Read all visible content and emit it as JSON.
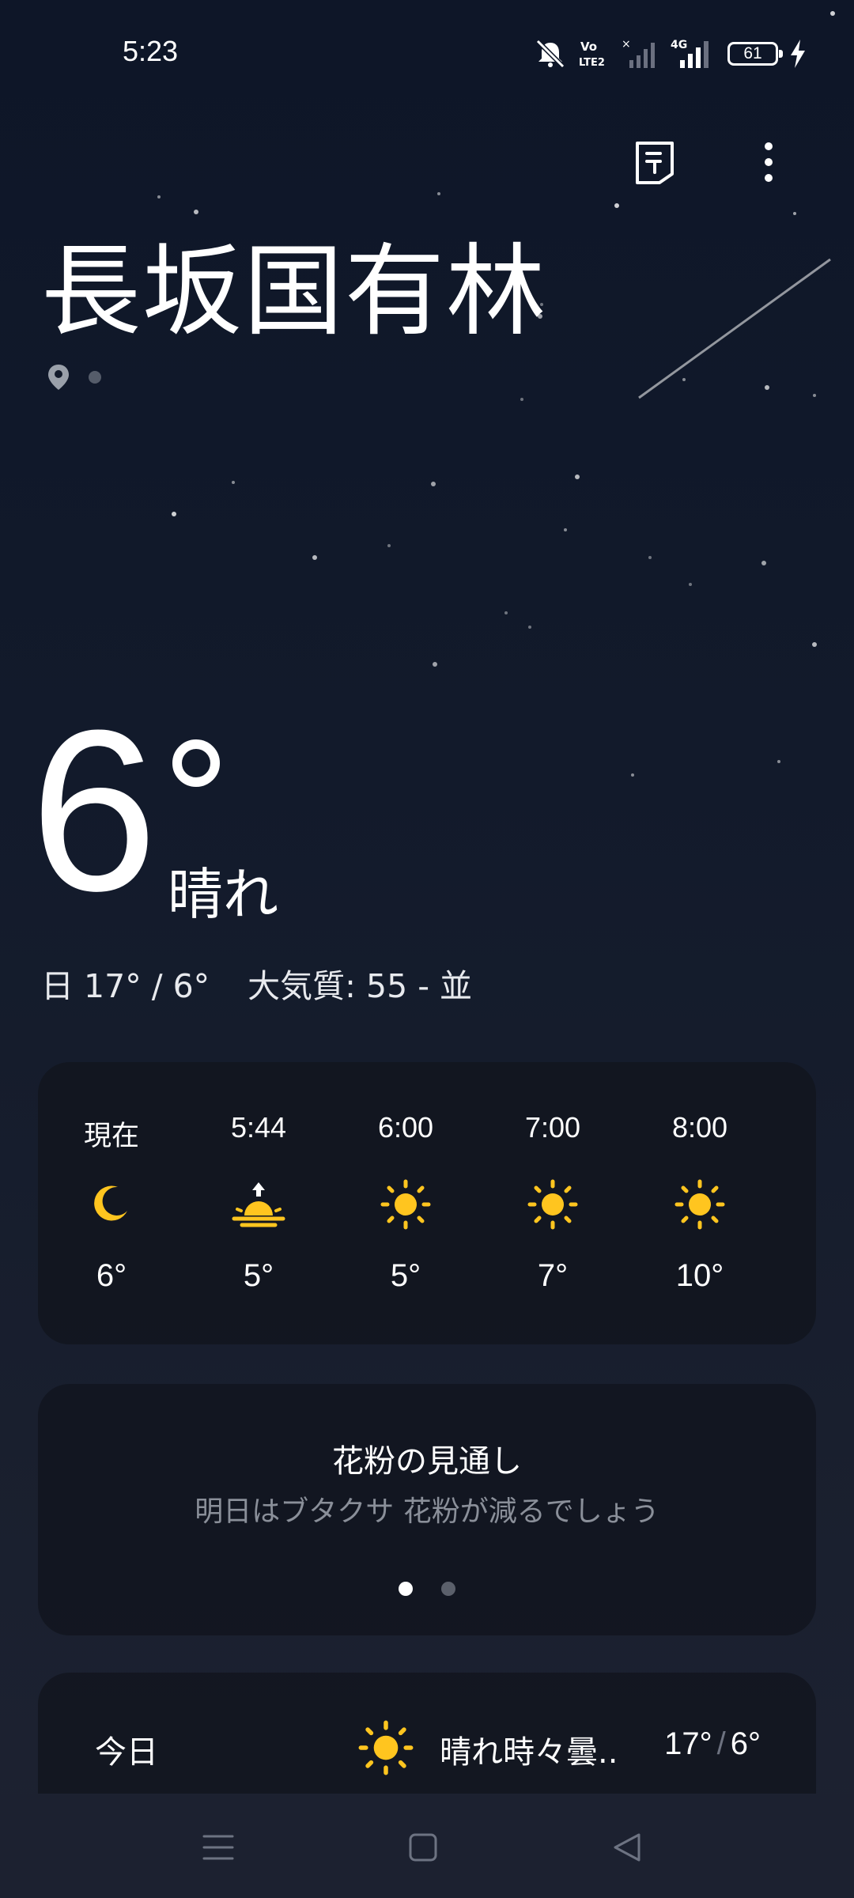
{
  "status_bar": {
    "time": "5:23",
    "battery": "61",
    "icons": [
      "mute-icon",
      "volte-icon",
      "signal-icon",
      "4g-signal-icon",
      "battery-icon",
      "charging-icon"
    ],
    "volte_label": "Vo LTE2",
    "network_label": "4G"
  },
  "toolbar": {
    "icons": [
      "document-icon",
      "more-vertical-icon"
    ]
  },
  "location": {
    "name": "長坂国有林"
  },
  "current": {
    "temperature": "6",
    "condition": "晴れ",
    "summary_day": "日 17° / 6°",
    "air_quality": "大気質: 55 - 並"
  },
  "hourly": [
    {
      "time": "現在",
      "icon": "moon-icon",
      "temp": "6°"
    },
    {
      "time": "5:44",
      "icon": "sunrise-icon",
      "temp": "5°"
    },
    {
      "time": "6:00",
      "icon": "sun-icon",
      "temp": "5°"
    },
    {
      "time": "7:00",
      "icon": "sun-icon",
      "temp": "7°"
    },
    {
      "time": "8:00",
      "icon": "sun-icon",
      "temp": "10°"
    }
  ],
  "pollen": {
    "title": "花粉の見通し",
    "text": "明日はブタクサ 花粉が減るでしょう",
    "pages": 2,
    "active_page": 1
  },
  "daily": [
    {
      "day": "今日",
      "icon": "sun-icon",
      "condition": "晴れ時々曇..",
      "high": "17°",
      "low": "6°",
      "separator": "/"
    }
  ],
  "colors": {
    "accent_yellow": "#ffc51f",
    "background": "#0f1524",
    "card": "#12151e"
  },
  "nav": {
    "icons": [
      "menu-icon",
      "home-icon",
      "back-icon"
    ]
  }
}
